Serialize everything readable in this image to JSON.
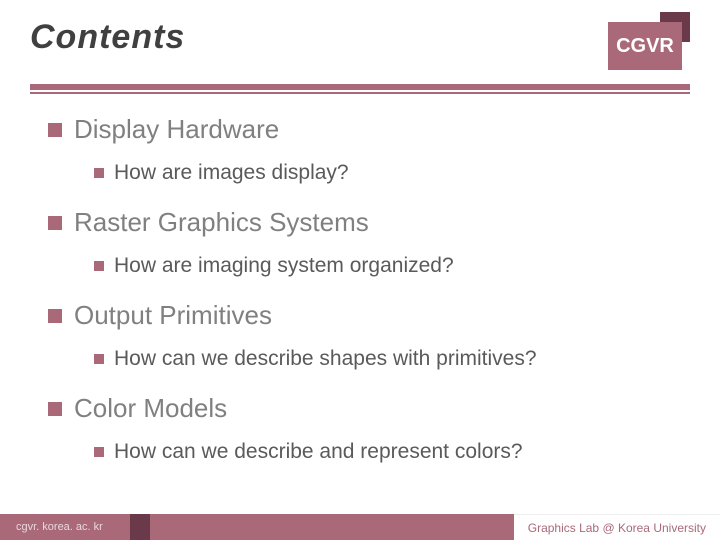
{
  "header": {
    "title": "Contents",
    "badge": "CGVR"
  },
  "items": [
    {
      "title": "Display Hardware",
      "sub": "How are images display?"
    },
    {
      "title": "Raster Graphics Systems",
      "sub": "How are imaging system organized?"
    },
    {
      "title": "Output Primitives",
      "sub": "How can we describe shapes with primitives?"
    },
    {
      "title": "Color Models",
      "sub": "How can we describe and represent colors?"
    }
  ],
  "footer": {
    "left": "cgvr. korea. ac. kr",
    "right": "Graphics Lab @ Korea University"
  }
}
